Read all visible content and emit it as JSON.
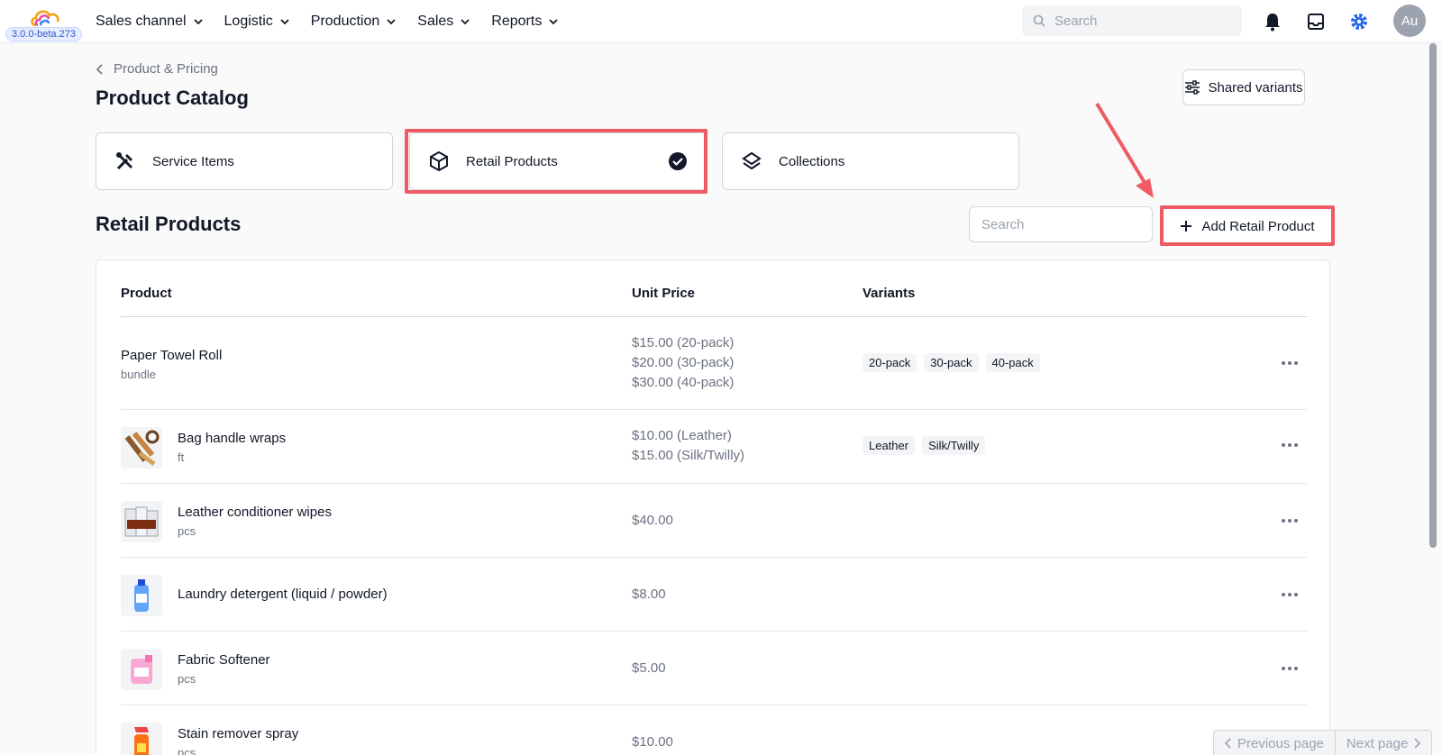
{
  "topbar": {
    "version": "3.0.0-beta.273",
    "nav": [
      "Sales channel",
      "Logistic",
      "Production",
      "Sales",
      "Reports"
    ],
    "search_placeholder": "Search",
    "avatar": "Au"
  },
  "header": {
    "breadcrumb": "Product & Pricing",
    "title": "Product Catalog",
    "shared_variants": "Shared variants"
  },
  "tabs": [
    {
      "label": "Service Items",
      "icon": "tools-icon"
    },
    {
      "label": "Retail Products",
      "icon": "box-icon",
      "selected": true
    },
    {
      "label": "Collections",
      "icon": "layers-icon"
    }
  ],
  "section": {
    "title": "Retail Products",
    "search_placeholder": "Search",
    "add_label": "Add Retail Product"
  },
  "table": {
    "columns": [
      "Product",
      "Unit Price",
      "Variants"
    ],
    "rows": [
      {
        "name": "Paper Towel Roll",
        "unit": "bundle",
        "prices": [
          "$15.00 (20-pack)",
          "$20.00 (30-pack)",
          "$30.00 (40-pack)"
        ],
        "variants": [
          "20-pack",
          "30-pack",
          "40-pack"
        ]
      },
      {
        "name": "Bag handle wraps",
        "unit": "ft",
        "prices": [
          "$10.00 (Leather)",
          "$15.00 (Silk/Twilly)"
        ],
        "variants": [
          "Leather",
          "Silk/Twilly"
        ]
      },
      {
        "name": "Leather conditioner wipes",
        "unit": "pcs",
        "prices": [
          "$40.00"
        ],
        "variants": []
      },
      {
        "name": "Laundry detergent (liquid / powder)",
        "unit": "",
        "prices": [
          "$8.00"
        ],
        "variants": []
      },
      {
        "name": "Fabric Softener",
        "unit": "pcs",
        "prices": [
          "$5.00"
        ],
        "variants": []
      },
      {
        "name": "Stain remover spray",
        "unit": "pcs",
        "prices": [
          "$10.00"
        ],
        "variants": []
      }
    ]
  },
  "pager": {
    "previous": "Previous page",
    "next": "Next page"
  },
  "colors": {
    "highlight": "#ef5b63",
    "accent": "#3056d3"
  }
}
